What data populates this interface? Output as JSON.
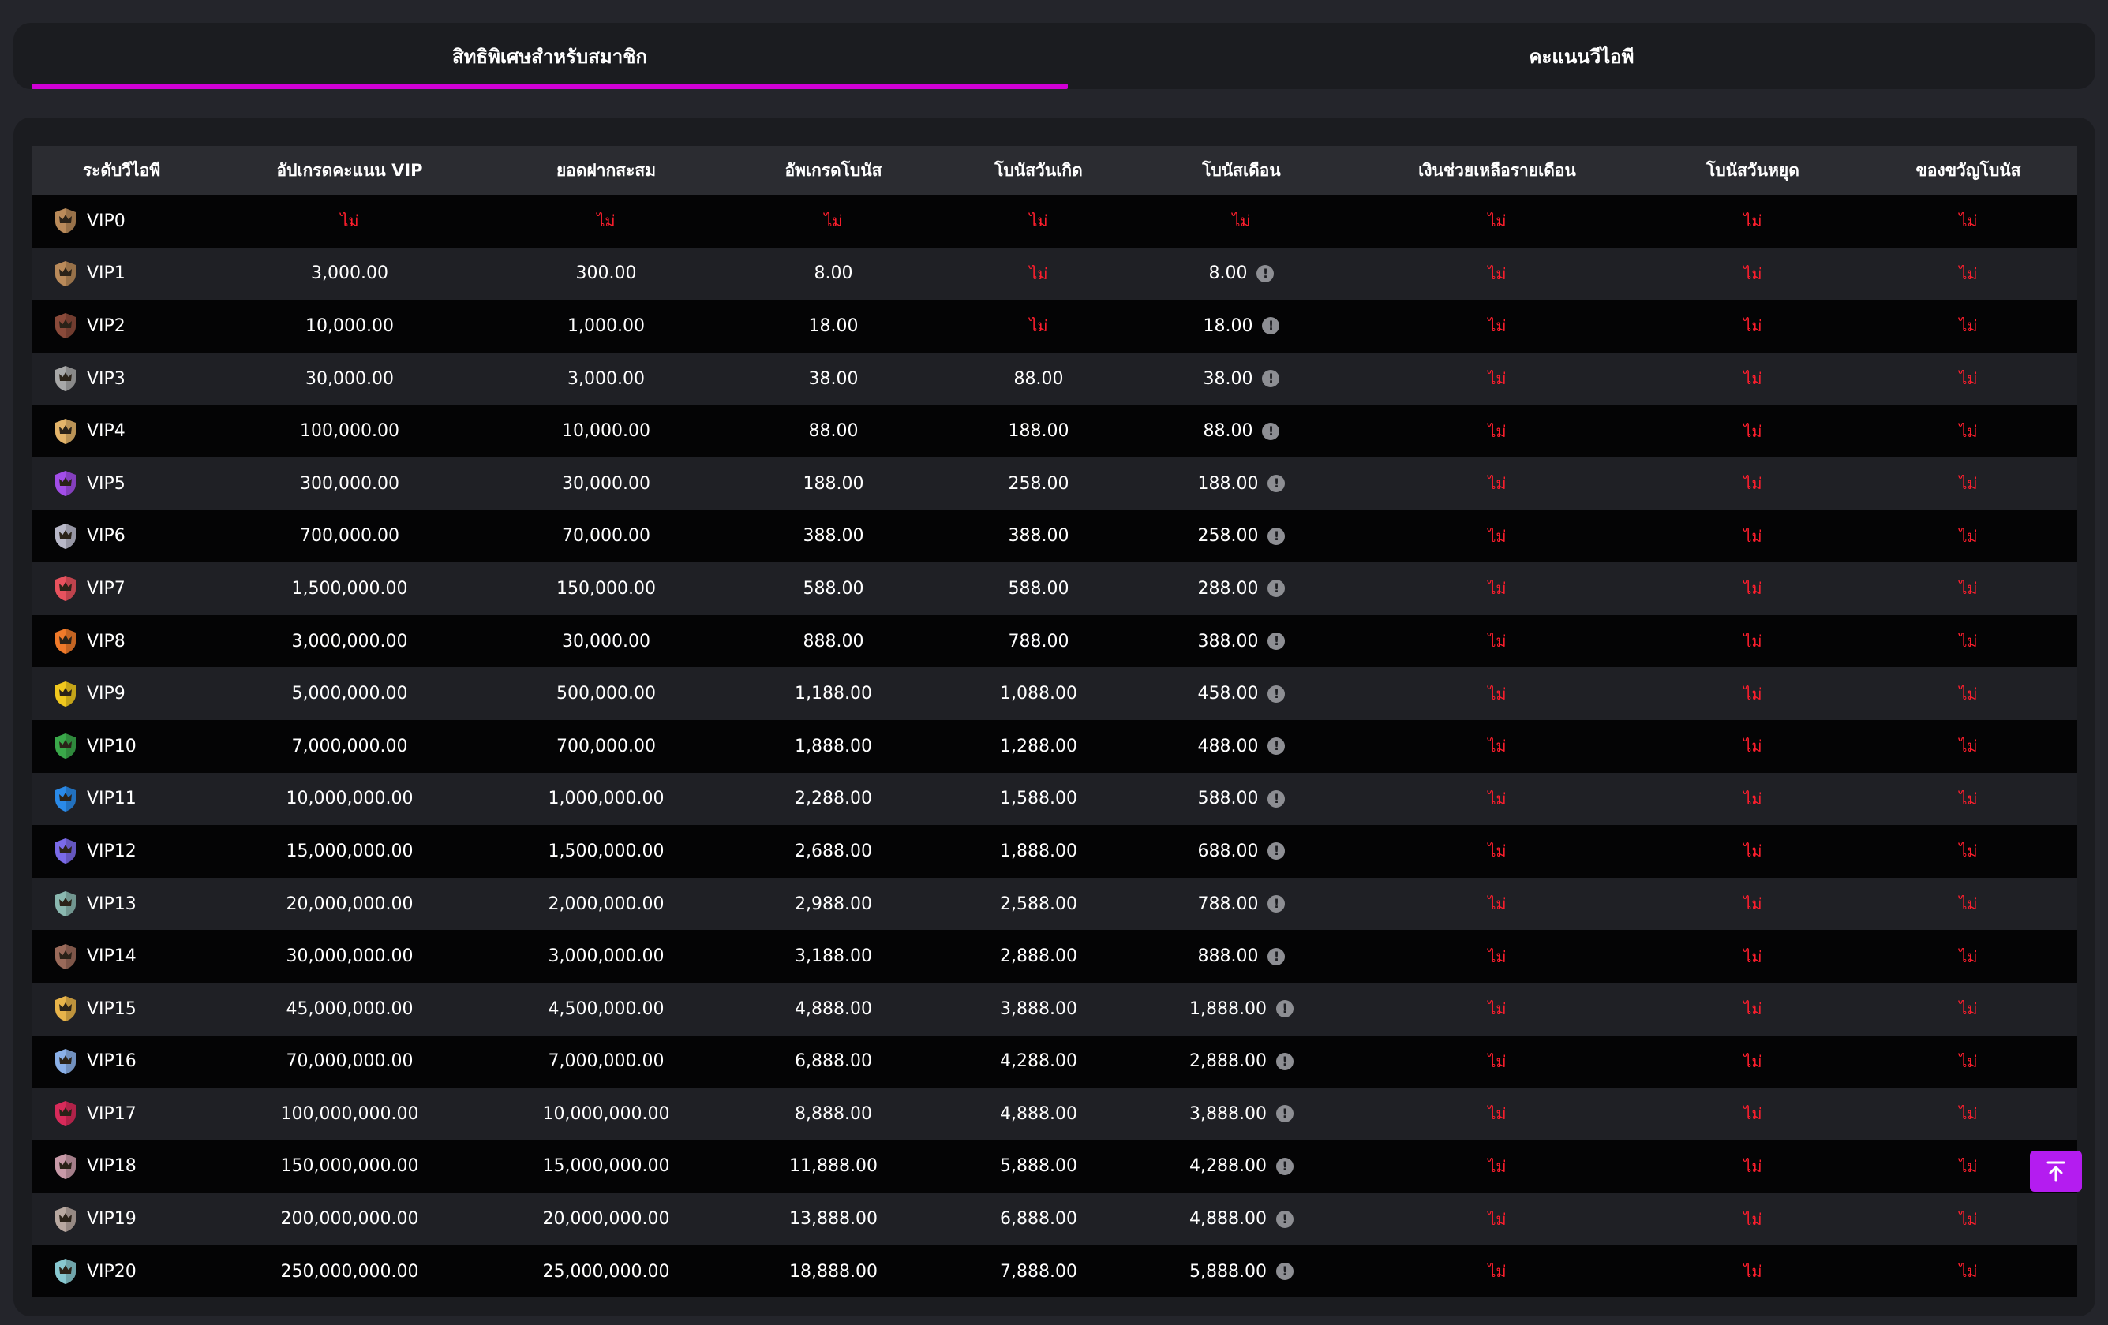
{
  "tabs": [
    {
      "label": "สิทธิพิเศษสำหรับสมาชิก",
      "active": true
    },
    {
      "label": "คะแนนวีไอพี",
      "active": false
    }
  ],
  "accent_color": "#d100d6",
  "no_color": "#ff1e2d",
  "table": {
    "headers": [
      "ระดับวีไอพี",
      "อัปเกรดคะแนน VIP",
      "ยอดฝากสะสม",
      "อัพเกรดโบนัส",
      "โบนัสวันเกิด",
      "โบนัสเดือน",
      "เงินช่วยเหลือรายเดือน",
      "โบนัสวันหยุด",
      "ของขวัญโบนัส"
    ],
    "no_text": "ไม่",
    "rows": [
      {
        "level": "VIP0",
        "badge_color": "#b98a5a",
        "upgrade_points": "ไม่",
        "deposit": "ไม่",
        "upgrade_bonus": "ไม่",
        "birthday_bonus": "ไม่",
        "monthly_bonus": "ไม่",
        "monthly_info": false
      },
      {
        "level": "VIP1",
        "badge_color": "#b98a5a",
        "upgrade_points": "3,000.00",
        "deposit": "300.00",
        "upgrade_bonus": "8.00",
        "birthday_bonus": "ไม่",
        "monthly_bonus": "8.00",
        "monthly_info": true
      },
      {
        "level": "VIP2",
        "badge_color": "#8a4a3a",
        "upgrade_points": "10,000.00",
        "deposit": "1,000.00",
        "upgrade_bonus": "18.00",
        "birthday_bonus": "ไม่",
        "monthly_bonus": "18.00",
        "monthly_info": true
      },
      {
        "level": "VIP3",
        "badge_color": "#a8a8a8",
        "upgrade_points": "30,000.00",
        "deposit": "3,000.00",
        "upgrade_bonus": "38.00",
        "birthday_bonus": "88.00",
        "monthly_bonus": "38.00",
        "monthly_info": true
      },
      {
        "level": "VIP4",
        "badge_color": "#e3b46a",
        "upgrade_points": "100,000.00",
        "deposit": "10,000.00",
        "upgrade_bonus": "88.00",
        "birthday_bonus": "188.00",
        "monthly_bonus": "88.00",
        "monthly_info": true
      },
      {
        "level": "VIP5",
        "badge_color": "#a24de8",
        "upgrade_points": "300,000.00",
        "deposit": "30,000.00",
        "upgrade_bonus": "188.00",
        "birthday_bonus": "258.00",
        "monthly_bonus": "188.00",
        "monthly_info": true
      },
      {
        "level": "VIP6",
        "badge_color": "#b8b8c8",
        "upgrade_points": "700,000.00",
        "deposit": "70,000.00",
        "upgrade_bonus": "388.00",
        "birthday_bonus": "388.00",
        "monthly_bonus": "258.00",
        "monthly_info": true
      },
      {
        "level": "VIP7",
        "badge_color": "#e8525e",
        "upgrade_points": "1,500,000.00",
        "deposit": "150,000.00",
        "upgrade_bonus": "588.00",
        "birthday_bonus": "588.00",
        "monthly_bonus": "288.00",
        "monthly_info": true
      },
      {
        "level": "VIP8",
        "badge_color": "#f07a2a",
        "upgrade_points": "3,000,000.00",
        "deposit": "30,000.00",
        "upgrade_bonus": "888.00",
        "birthday_bonus": "788.00",
        "monthly_bonus": "388.00",
        "monthly_info": true
      },
      {
        "level": "VIP9",
        "badge_color": "#f0c81e",
        "upgrade_points": "5,000,000.00",
        "deposit": "500,000.00",
        "upgrade_bonus": "1,188.00",
        "birthday_bonus": "1,088.00",
        "monthly_bonus": "458.00",
        "monthly_info": true
      },
      {
        "level": "VIP10",
        "badge_color": "#3aa84a",
        "upgrade_points": "7,000,000.00",
        "deposit": "700,000.00",
        "upgrade_bonus": "1,888.00",
        "birthday_bonus": "1,288.00",
        "monthly_bonus": "488.00",
        "monthly_info": true
      },
      {
        "level": "VIP11",
        "badge_color": "#2a8ae8",
        "upgrade_points": "10,000,000.00",
        "deposit": "1,000,000.00",
        "upgrade_bonus": "2,288.00",
        "birthday_bonus": "1,588.00",
        "monthly_bonus": "588.00",
        "monthly_info": true
      },
      {
        "level": "VIP12",
        "badge_color": "#7a6ae8",
        "upgrade_points": "15,000,000.00",
        "deposit": "1,500,000.00",
        "upgrade_bonus": "2,688.00",
        "birthday_bonus": "1,888.00",
        "monthly_bonus": "688.00",
        "monthly_info": true
      },
      {
        "level": "VIP13",
        "badge_color": "#8ab8b0",
        "upgrade_points": "20,000,000.00",
        "deposit": "2,000,000.00",
        "upgrade_bonus": "2,988.00",
        "birthday_bonus": "2,588.00",
        "monthly_bonus": "788.00",
        "monthly_info": true
      },
      {
        "level": "VIP14",
        "badge_color": "#9a6a5a",
        "upgrade_points": "30,000,000.00",
        "deposit": "3,000,000.00",
        "upgrade_bonus": "3,188.00",
        "birthday_bonus": "2,888.00",
        "monthly_bonus": "888.00",
        "monthly_info": true
      },
      {
        "level": "VIP15",
        "badge_color": "#e8b44a",
        "upgrade_points": "45,000,000.00",
        "deposit": "4,500,000.00",
        "upgrade_bonus": "4,888.00",
        "birthday_bonus": "3,888.00",
        "monthly_bonus": "1,888.00",
        "monthly_info": true
      },
      {
        "level": "VIP16",
        "badge_color": "#8ab0e8",
        "upgrade_points": "70,000,000.00",
        "deposit": "7,000,000.00",
        "upgrade_bonus": "6,888.00",
        "birthday_bonus": "4,288.00",
        "monthly_bonus": "2,888.00",
        "monthly_info": true
      },
      {
        "level": "VIP17",
        "badge_color": "#d82a5a",
        "upgrade_points": "100,000,000.00",
        "deposit": "10,000,000.00",
        "upgrade_bonus": "8,888.00",
        "birthday_bonus": "4,888.00",
        "monthly_bonus": "3,888.00",
        "monthly_info": true
      },
      {
        "level": "VIP18",
        "badge_color": "#c89aa8",
        "upgrade_points": "150,000,000.00",
        "deposit": "15,000,000.00",
        "upgrade_bonus": "11,888.00",
        "birthday_bonus": "5,888.00",
        "monthly_bonus": "4,288.00",
        "monthly_info": true
      },
      {
        "level": "VIP19",
        "badge_color": "#b8a8a0",
        "upgrade_points": "200,000,000.00",
        "deposit": "20,000,000.00",
        "upgrade_bonus": "13,888.00",
        "birthday_bonus": "6,888.00",
        "monthly_bonus": "4,888.00",
        "monthly_info": true
      },
      {
        "level": "VIP20",
        "badge_color": "#88c8d0",
        "upgrade_points": "250,000,000.00",
        "deposit": "25,000,000.00",
        "upgrade_bonus": "18,888.00",
        "birthday_bonus": "7,888.00",
        "monthly_bonus": "5,888.00",
        "monthly_info": true
      }
    ]
  },
  "icons": {
    "info": "info-icon",
    "badge": "crown-shield-icon",
    "scroll_top": "arrow-up-to-top-icon"
  },
  "info_glyph": "!"
}
